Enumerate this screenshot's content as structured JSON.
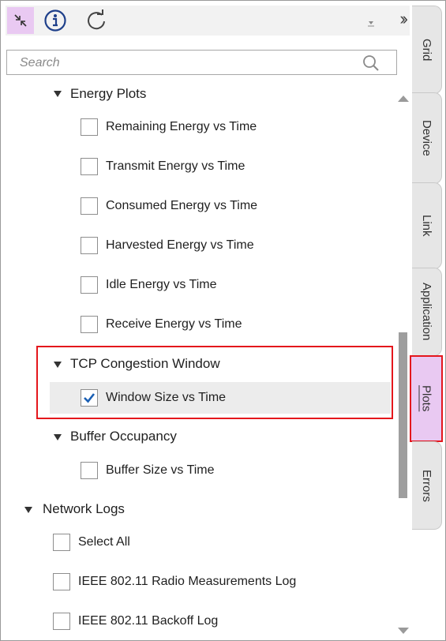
{
  "toolbar": {
    "buttons": [
      "collapse-icon",
      "info-icon",
      "refresh-icon"
    ],
    "expand_icon": "double-chevron-right-icon"
  },
  "search": {
    "placeholder": "Search"
  },
  "tree": {
    "energy": {
      "label": "Energy Plots",
      "items": [
        "Remaining Energy vs Time",
        "Transmit Energy vs Time",
        "Consumed Energy vs Time",
        "Harvested Energy vs Time",
        "Idle Energy vs Time",
        "Receive Energy vs Time"
      ]
    },
    "tcp": {
      "label": "TCP Congestion Window",
      "items": [
        "Window Size vs Time"
      ]
    },
    "buffer": {
      "label": "Buffer Occupancy",
      "items": [
        "Buffer Size vs Time"
      ]
    },
    "logs": {
      "label": "Network Logs",
      "items": [
        "Select All",
        "IEEE 802.11 Radio Measurements Log",
        "IEEE 802.11 Backoff Log"
      ]
    }
  },
  "tabs": [
    "Grid",
    "Device",
    "Link",
    "Application",
    "Plots",
    "Errors"
  ],
  "active_tab": "Plots",
  "colors": {
    "accent": "#e9c9f2",
    "highlight_border": "#e4171c",
    "check": "#1a5fb4"
  }
}
